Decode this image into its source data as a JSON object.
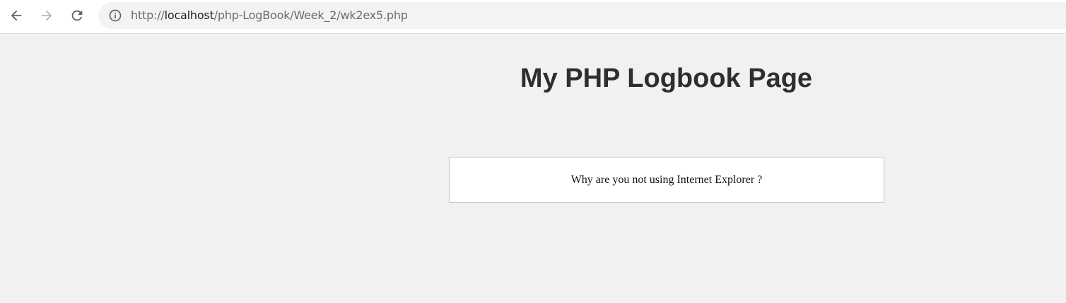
{
  "browser": {
    "url_prefix": "http://",
    "url_host": "localhost",
    "url_path": "/php-LogBook/Week_2/wk2ex5.php",
    "icons": {
      "back": "arrow-left-icon",
      "forward": "arrow-right-icon",
      "reload": "reload-icon",
      "site_info": "info-circle-icon"
    }
  },
  "page": {
    "title": "My PHP Logbook Page",
    "message": "Why are you not using Internet Explorer ?"
  },
  "colors": {
    "page_background": "#f1f1f1",
    "title": "#2e2e2e",
    "box_background": "#ffffff",
    "box_border": "#c8c8c8"
  }
}
